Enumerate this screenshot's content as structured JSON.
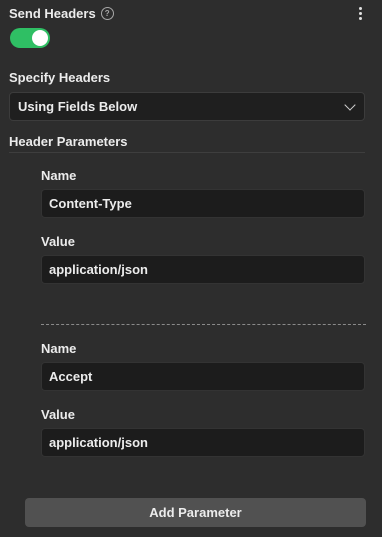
{
  "send_headers": {
    "label": "Send Headers",
    "help_glyph": "?",
    "enabled": true,
    "toggle_color": "#2fbf64"
  },
  "specify_headers": {
    "label": "Specify Headers",
    "selected": "Using Fields Below"
  },
  "header_parameters": {
    "label": "Header Parameters",
    "params": [
      {
        "name_label": "Name",
        "name_value": "Content-Type",
        "value_label": "Value",
        "value_value": "application/json"
      },
      {
        "name_label": "Name",
        "name_value": "Accept",
        "value_label": "Value",
        "value_value": "application/json"
      }
    ]
  },
  "add_parameter_label": "Add Parameter",
  "icons": {
    "help": "help-circle-icon",
    "menu": "kebab-menu-icon",
    "chevron": "chevron-down-icon"
  }
}
